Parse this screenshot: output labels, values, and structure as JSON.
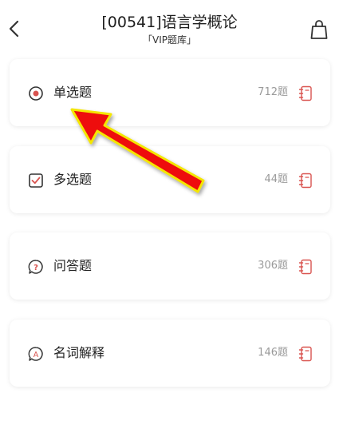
{
  "header": {
    "title": "[00541]语言学概论",
    "subtitle": "「VIP题库」",
    "back_icon": "chevron-left-icon",
    "bag_icon": "shopping-bag-icon"
  },
  "categories": [
    {
      "label": "单选题",
      "count": "712题",
      "icon": "radio-icon"
    },
    {
      "label": "多选题",
      "count": "44题",
      "icon": "checkbox-icon"
    },
    {
      "label": "问答题",
      "count": "306题",
      "icon": "question-bubble-icon"
    },
    {
      "label": "名词解释",
      "count": "146题",
      "icon": "letter-a-bubble-icon"
    }
  ],
  "colors": {
    "accent": "#d9534f",
    "annotation_arrow": "#ee1010",
    "annotation_glow": "#f4e600"
  }
}
